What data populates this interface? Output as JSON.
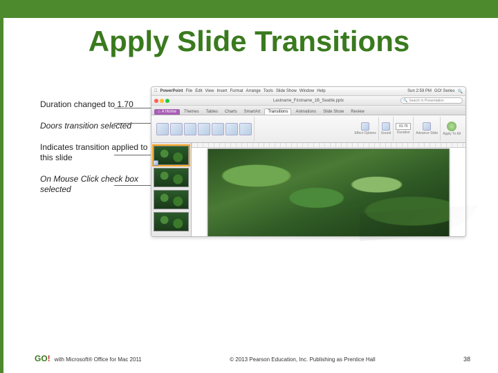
{
  "title": "Apply Slide Transitions",
  "callouts": {
    "duration": "Duration changed to 1.70",
    "transition": "Doors transition selected",
    "indicator": "Indicates transition applied to this slide",
    "mouseclick": "On Mouse Click check box selected"
  },
  "mac_menu": {
    "app": "PowerPoint",
    "items": [
      "File",
      "Edit",
      "View",
      "Insert",
      "Format",
      "Arrange",
      "Tools",
      "Slide Show",
      "Window",
      "Help"
    ],
    "clock": "Sun 2:59 PM",
    "user": "GO! Series"
  },
  "window": {
    "document": "Lastname_Firstname_1B_Seattle.pptx",
    "search_placeholder": "Search in Presentation"
  },
  "tabs": {
    "home": "A Home",
    "list": [
      "Themes",
      "Tables",
      "Charts",
      "SmartArt",
      "Transitions",
      "Animations",
      "Slide Show",
      "Review"
    ],
    "active": "Transitions"
  },
  "ribbon": {
    "duration_label": "Duration",
    "duration_value": "01.70",
    "effect_options": "Effect Options",
    "sound": "Sound",
    "advance": "Advance Slide",
    "apply_all": "Apply To All"
  },
  "footer": {
    "logo_go": "GO",
    "logo_ex": "!",
    "book": "with Microsoft® Office for Mac 2011",
    "copyright": "© 2013 Pearson Education, Inc. Publishing as Prentice Hall",
    "page": "38"
  }
}
